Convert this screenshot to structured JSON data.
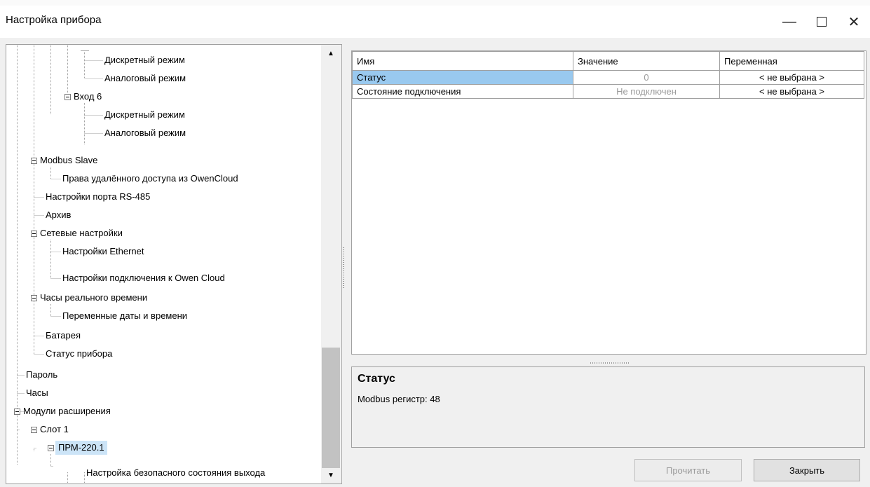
{
  "window": {
    "title": "Настройка прибора",
    "minimize_glyph": "—",
    "close_glyph": "✕"
  },
  "tree": {
    "items": [
      {
        "label": "Дискретный режим",
        "level": 4
      },
      {
        "label": "Аналоговый режим",
        "level": 4
      },
      {
        "label": "Вход 6",
        "level": 3,
        "expanded": true
      },
      {
        "label": "Дискретный режим",
        "level": 4
      },
      {
        "label": "Аналоговый режим",
        "level": 4
      },
      {
        "label": "Modbus Slave",
        "level": 2,
        "expanded": true
      },
      {
        "label": "Права удалённого доступа из OwenCloud",
        "level": 3
      },
      {
        "label": "Настройки порта RS-485",
        "level": 2
      },
      {
        "label": "Архив",
        "level": 2
      },
      {
        "label": "Сетевые настройки",
        "level": 2,
        "expanded": true
      },
      {
        "label": "Настройки Ethernet",
        "level": 3
      },
      {
        "label": "Настройки подключения к Owen Cloud",
        "level": 3
      },
      {
        "label": "Часы реального времени",
        "level": 2,
        "expanded": true
      },
      {
        "label": "Переменные даты и времени",
        "level": 3
      },
      {
        "label": "Батарея",
        "level": 2
      },
      {
        "label": "Статус прибора",
        "level": 2
      },
      {
        "label": "Пароль",
        "level": 1
      },
      {
        "label": "Часы",
        "level": 1
      },
      {
        "label": "Модули расширения",
        "level": 1,
        "expanded": true
      },
      {
        "label": "Слот 1",
        "level": 2,
        "expanded": true
      },
      {
        "label": "ПРМ-220.1",
        "level": 3,
        "expanded": true,
        "selected": true
      },
      {
        "label": "Настройка безопасного состояния выхода",
        "level": 4
      }
    ],
    "scroll_up_glyph": "▲",
    "scroll_down_glyph": "▼"
  },
  "grid": {
    "headers": [
      "Имя",
      "Значение",
      "Переменная"
    ],
    "rows": [
      {
        "name": "Статус",
        "value": "0",
        "variable": "< не выбрана >"
      },
      {
        "name": "Состояние подключения",
        "value": "Не подключен",
        "variable": "< не выбрана >"
      }
    ]
  },
  "description": {
    "title": "Статус",
    "text": "Modbus регистр: 48"
  },
  "buttons": {
    "read": "Прочитать",
    "close": "Закрыть"
  },
  "colors": {
    "selection": "#99c9ef",
    "tree_selection": "#cce4f7",
    "window_bg": "#f0f0f0"
  }
}
